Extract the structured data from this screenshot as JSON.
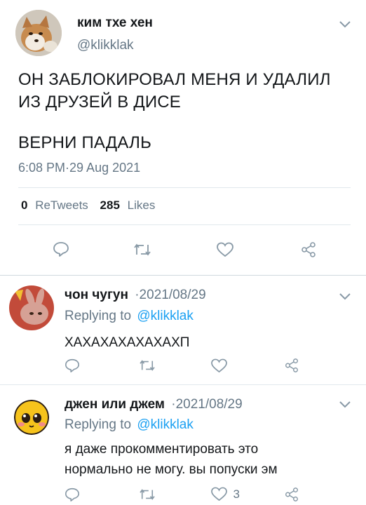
{
  "main_tweet": {
    "author_name": "ким тхе хен",
    "author_handle": "@klikklak",
    "text_line1": "ОН ЗАБЛОКИРОВАЛ МЕНЯ И УДАЛИЛ",
    "text_line2": "ИЗ ДРУЗЕЙ В ДИСЕ",
    "text_line3": "ВЕРНИ ПАДАЛЬ",
    "timestamp": "6:08 PM·29 Aug 2021",
    "retweet_count": "0",
    "retweet_label": "ReTweets",
    "like_count": "285",
    "like_label": "Likes"
  },
  "replies": [
    {
      "author_name": "чон чугун",
      "date": "·2021/08/29",
      "replying_prefix": "Replying to",
      "replying_handle": "@klikklak",
      "text_line1": "ХАХАХАХАХАХАХП",
      "like_count": ""
    },
    {
      "author_name": "джен или джем",
      "date": "·2021/08/29",
      "replying_prefix": "Replying to",
      "replying_handle": "@klikklak",
      "text_line1": "я даже прокомментировать это",
      "text_line2": "нормально не могу. вы попуски эм",
      "like_count": "3"
    }
  ],
  "colors": {
    "accent": "#1da1f2",
    "secondary_text": "#657786",
    "divider": "#e1e8ed"
  },
  "icons": [
    "chevron-down-icon",
    "reply-icon",
    "retweet-icon",
    "like-icon",
    "share-icon"
  ]
}
